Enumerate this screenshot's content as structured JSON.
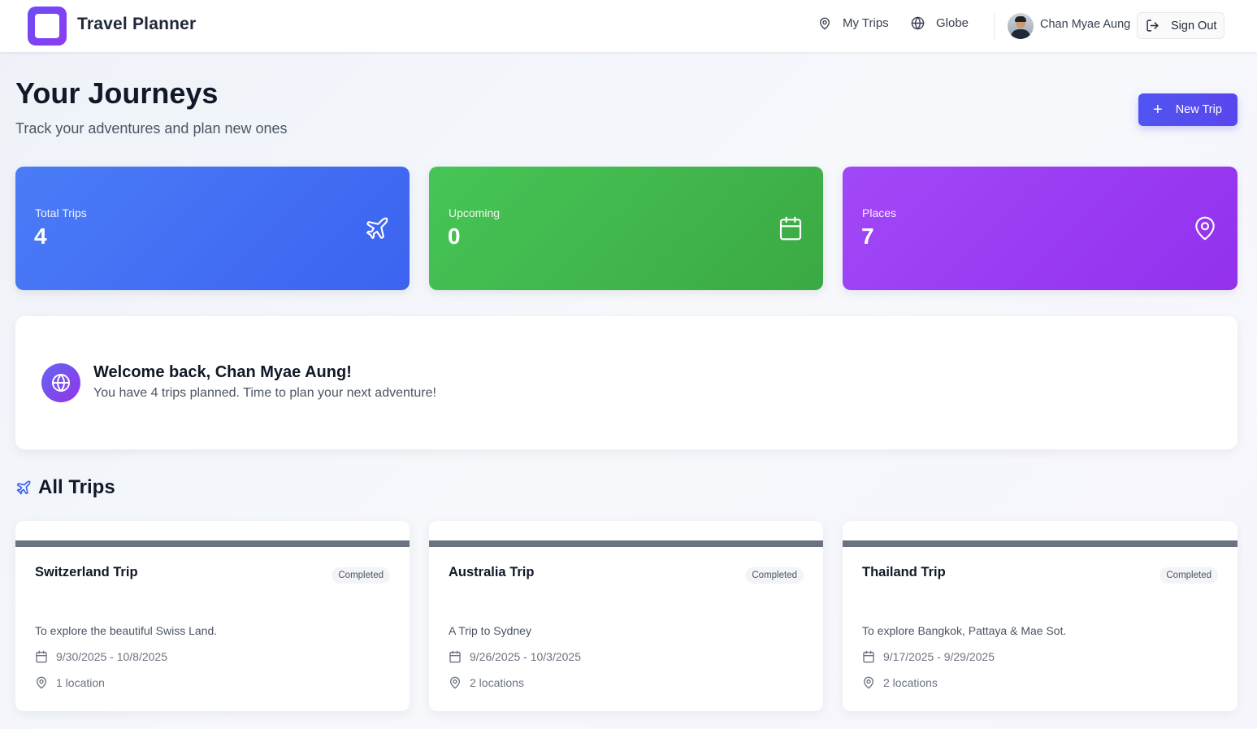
{
  "header": {
    "brand": "Travel Planner",
    "nav": [
      {
        "label": "My Trips",
        "icon": "map-pin-icon"
      },
      {
        "label": "Globe",
        "icon": "globe-icon"
      }
    ],
    "user_name": "Chan Myae Aung",
    "sign_out_label": "Sign Out"
  },
  "hero": {
    "title": "Your Journeys",
    "subtitle": "Track your adventures and plan new ones",
    "new_trip_label": "New Trip"
  },
  "stats": [
    {
      "label": "Total Trips",
      "value": "4",
      "icon": "plane-icon",
      "color": "#3c63f0"
    },
    {
      "label": "Upcoming",
      "value": "0",
      "icon": "calendar-icon",
      "color": "#3ba943"
    },
    {
      "label": "Places",
      "value": "7",
      "icon": "map-pin-icon",
      "color": "#9331ee"
    }
  ],
  "welcome": {
    "title": "Welcome back, Chan Myae Aung!",
    "text": "You have 4 trips planned. Time to plan your next adventure!"
  },
  "section": {
    "title": "All Trips"
  },
  "trips": [
    {
      "title": "Switzerland Trip",
      "status": "Completed",
      "description": "To explore the beautiful Swiss Land.",
      "dates": "9/30/2025 - 10/8/2025",
      "locations": "1 location"
    },
    {
      "title": "Australia Trip",
      "status": "Completed",
      "description": "A Trip to Sydney",
      "dates": "9/26/2025 - 10/3/2025",
      "locations": "2 locations"
    },
    {
      "title": "Thailand Trip",
      "status": "Completed",
      "description": "To explore Bangkok, Pattaya & Mae Sot.",
      "dates": "9/17/2025 - 9/29/2025",
      "locations": "2 locations"
    }
  ]
}
